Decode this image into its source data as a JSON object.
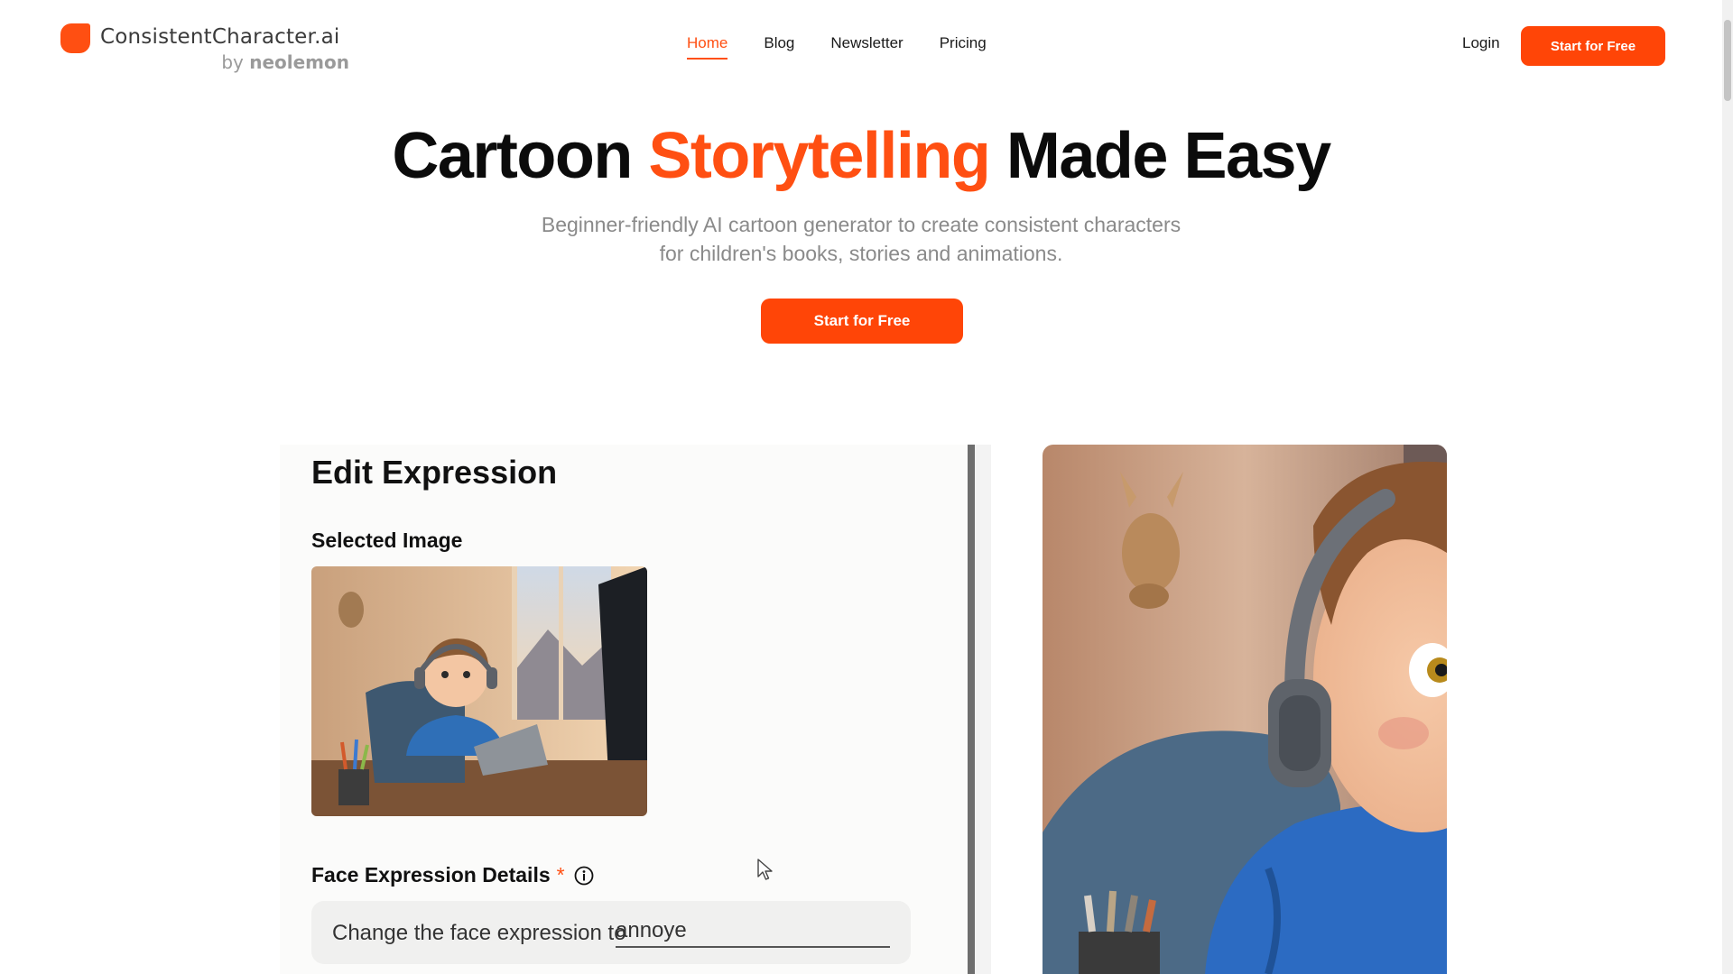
{
  "brand": {
    "name": "ConsistentCharacter.ai",
    "by": "by",
    "by_brand": "neolemon",
    "accent_color": "#ff4f12"
  },
  "nav": {
    "links": [
      {
        "label": "Home",
        "active": true
      },
      {
        "label": "Blog",
        "active": false
      },
      {
        "label": "Newsletter",
        "active": false
      },
      {
        "label": "Pricing",
        "active": false
      }
    ],
    "login": "Login",
    "cta": "Start for Free"
  },
  "hero": {
    "title_before": "Cartoon ",
    "title_accent": "Storytelling",
    "title_after": " Made Easy",
    "subtitle_line1": "Beginner-friendly AI cartoon generator to create consistent characters",
    "subtitle_line2": "for children's books, stories and animations.",
    "cta": "Start for Free"
  },
  "demo": {
    "editor_title": "Edit Expression",
    "selected_image_label": "Selected Image",
    "face_expression_label": "Face Expression Details",
    "required_marker": "*",
    "info_icon": "info-icon",
    "prompt_prefix": "Change the face expression to",
    "prompt_value": "annoye",
    "cursor_icon": "mouse-pointer-icon"
  }
}
